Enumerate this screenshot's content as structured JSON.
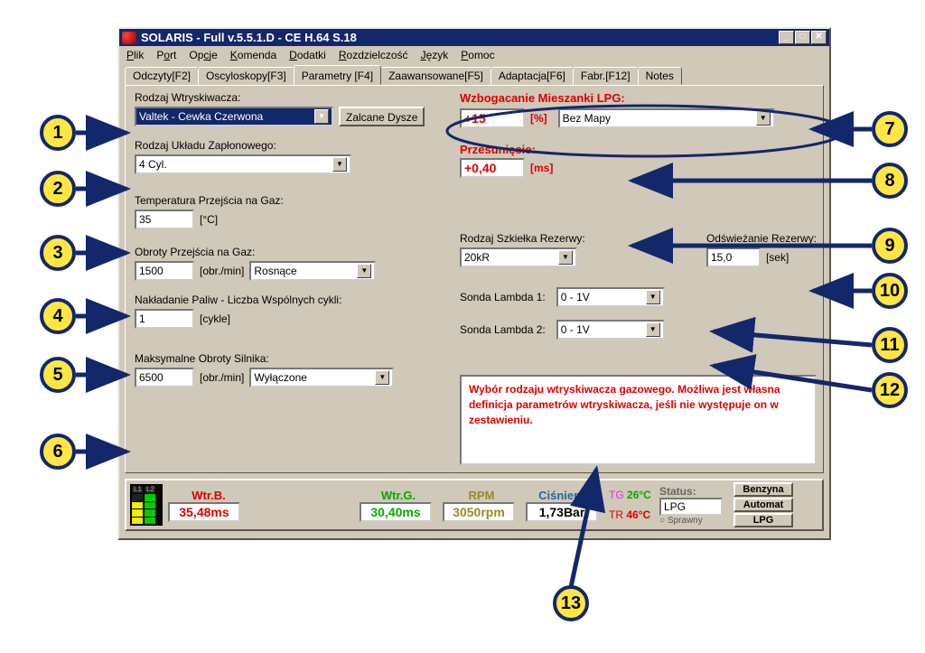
{
  "title": "SOLARIS - Full v.5.5.1.D - CE H.64 S.18",
  "menu": [
    "Plik",
    "Port",
    "Opcje",
    "Komenda",
    "Dodatki",
    "Rozdzielczość",
    "Język",
    "Pomoc"
  ],
  "tabs": [
    "Odczyty[F2]",
    "Oscyloskopy[F3]",
    "Parametry [F4]",
    "Zaawansowane[F5]",
    "Adaptacja[F6]",
    "Fabr.[F12]",
    "Notes"
  ],
  "active_tab": 2,
  "left": {
    "injector_label": "Rodzaj Wtryskiwacza:",
    "injector_value": "Valtek - Cewka Czerwona",
    "zalc_btn": "Zalcane Dysze",
    "ignition_label": "Rodzaj Układu Zapłonowego:",
    "ignition_value": "4 Cyl.",
    "temp_label": "Temperatura Przejścia na Gaz:",
    "temp_value": "35",
    "temp_unit": "[°C]",
    "rpm_label": "Obroty Przejścia na Gaz:",
    "rpm_value": "1500",
    "rpm_unit": "[obr./min]",
    "rpm_mode": "Rosnące",
    "overlap_label": "Nakładanie Paliw - Liczba Wspólnych cykli:",
    "overlap_value": "1",
    "overlap_unit": "[cykle]",
    "maxrpm_label": "Maksymalne Obroty Silnika:",
    "maxrpm_value": "6500",
    "maxrpm_unit": "[obr./min]",
    "maxrpm_mode": "Wyłączone"
  },
  "right": {
    "enrich_label": "Wzbogacanie Mieszanki LPG:",
    "enrich_value": "+15",
    "enrich_unit": "[%]",
    "enrich_map": "Bez Mapy",
    "shift_label": "Przesunięcie:",
    "shift_value": "+0,40",
    "shift_unit": "[ms]",
    "reserve_glass_label": "Rodzaj Szkiełka Rezerwy:",
    "reserve_glass_value": "20kR",
    "refresh_label": "Odświeżanie Rezerwy:",
    "refresh_value": "15,0",
    "refresh_unit": "[sek]",
    "lambda1_label": "Sonda Lambda 1:",
    "lambda1_value": "0 - 1V",
    "lambda2_label": "Sonda Lambda 2:",
    "lambda2_value": "0 - 1V",
    "help": "Wybór rodzaju wtryskiwacza gazowego. Możliwa jest własna definicja parametrów wtryskiwacza, jeśli nie występuje on w zestawieniu."
  },
  "status": {
    "wtrb_label": "Wtr.B.",
    "wtrb_value": "35,48ms",
    "wtrg_label": "Wtr.G.",
    "wtrg_value": "30,40ms",
    "rpm_label": "RPM",
    "rpm_value": "3050rpm",
    "press_label": "Ciśnienie",
    "press_value": "1,73Bar",
    "tg_label": "TG",
    "tg_value": "26°C",
    "tr_label": "TR",
    "tr_value": "46°C",
    "status_label": "Status:",
    "status_value": "LPG",
    "sprawny": "Sprawny",
    "mode1": "Benzyna",
    "mode2": "Automat",
    "mode3": "LPG",
    "l1": "L1",
    "l2": "L2"
  },
  "callouts": [
    "1",
    "2",
    "3",
    "4",
    "5",
    "6",
    "7",
    "8",
    "9",
    "10",
    "11",
    "12",
    "13"
  ]
}
